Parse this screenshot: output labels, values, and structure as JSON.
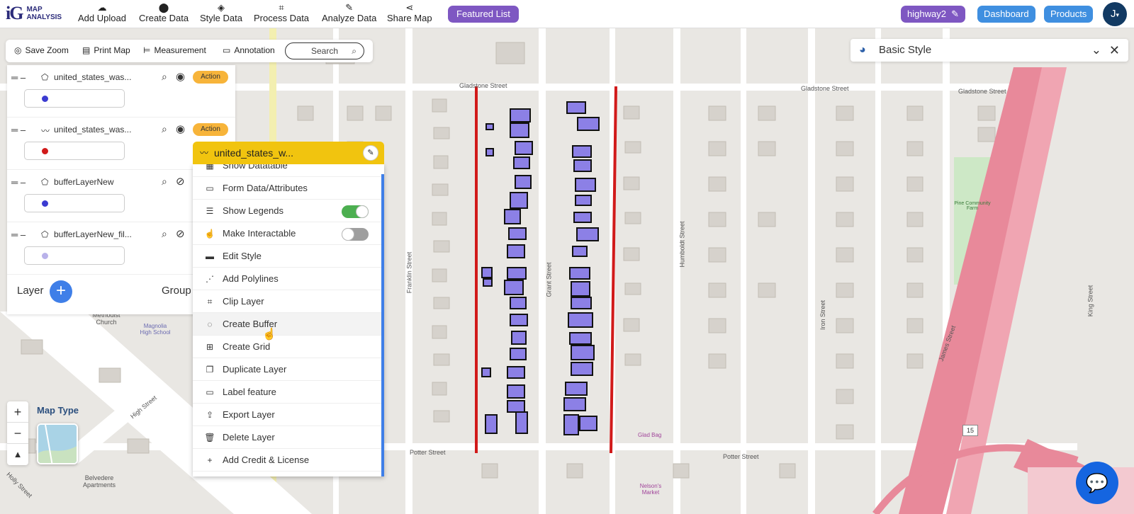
{
  "app": {
    "logo_mark": "iG",
    "logo_line1": "MAP",
    "logo_line2": "ANALYSIS"
  },
  "nav": {
    "items": [
      {
        "label": "Add Upload",
        "icon": "cloud-upload-icon"
      },
      {
        "label": "Create Data",
        "icon": "location-pin-icon"
      },
      {
        "label": "Style Data",
        "icon": "paint-bucket-icon"
      },
      {
        "label": "Process Data",
        "icon": "process-icon"
      },
      {
        "label": "Analyze Data",
        "icon": "analyze-icon"
      },
      {
        "label": "Share Map",
        "icon": "share-icon"
      }
    ],
    "featured_label": "Featured List",
    "project_label": "highway2",
    "dashboard_label": "Dashboard",
    "products_label": "Products",
    "avatar_label": "J",
    "accent_purple": "#7e57c2",
    "accent_blue": "#3f7fe8"
  },
  "toolbar": {
    "save_zoom": "Save Zoom",
    "print_map": "Print Map",
    "measurement": "Measurement",
    "annotation": "Annotation",
    "search_placeholder": "Search"
  },
  "layers": {
    "items": [
      {
        "name": "united_states_was...",
        "type": "polygon",
        "color": "#3b3bd1",
        "action": "Action",
        "visible": true
      },
      {
        "name": "united_states_was...",
        "type": "line",
        "color": "#d11a1a",
        "action": "Action",
        "visible": true
      },
      {
        "name": "bufferLayerNew",
        "type": "polygon",
        "color": "#3b3bd1",
        "visible": false
      },
      {
        "name": "bufferLayerNew_fil...",
        "type": "polygon",
        "color": "#b9b2ea",
        "visible": false
      }
    ],
    "layer_label": "Layer",
    "group_label": "Group"
  },
  "context_menu": {
    "title": "united_states_w...",
    "items": [
      {
        "label": "Show Datatable",
        "icon": "table-icon"
      },
      {
        "label": "Form Data/Attributes",
        "icon": "form-icon"
      },
      {
        "label": "Show Legends",
        "icon": "legend-icon",
        "toggle": true
      },
      {
        "label": "Make Interactable",
        "icon": "hand-pointer-icon",
        "toggle": false
      },
      {
        "label": "Edit Style",
        "icon": "edit-style-icon"
      },
      {
        "label": "Add Polylines",
        "icon": "polyline-icon"
      },
      {
        "label": "Clip Layer",
        "icon": "crop-icon"
      },
      {
        "label": "Create Buffer",
        "icon": "buffer-icon"
      },
      {
        "label": "Create Grid",
        "icon": "grid-icon"
      },
      {
        "label": "Duplicate Layer",
        "icon": "duplicate-icon"
      },
      {
        "label": "Label feature",
        "icon": "label-icon"
      },
      {
        "label": "Export Layer",
        "icon": "export-icon"
      },
      {
        "label": "Delete Layer",
        "icon": "trash-icon"
      },
      {
        "label": "Add Credit & License",
        "icon": "plus-icon"
      }
    ]
  },
  "style_panel": {
    "title": "Basic Style"
  },
  "map": {
    "type_label": "Map Type",
    "streets": {
      "gladstone": "Gladstone Street",
      "potter": "Potter Street",
      "franklin": "Franklin Street",
      "grant": "Grant Street",
      "humboldt": "Humboldt Street",
      "iron": "Iron Street",
      "james": "James Street",
      "king": "King Street",
      "high": "High Street",
      "holly": "Holly Street"
    },
    "poi": {
      "church": "Methodist Church",
      "school": "Magnolia High School",
      "farm": "Pine Community Farm",
      "glad_bag": "Glad Bag",
      "market": "Nelson's Market",
      "apartments": "Belvedere Apartments",
      "highway_shield": "15"
    },
    "colors": {
      "line_red": "#d11a1a",
      "building_fill": "#8c80e6",
      "highway": "#e8899a"
    }
  }
}
